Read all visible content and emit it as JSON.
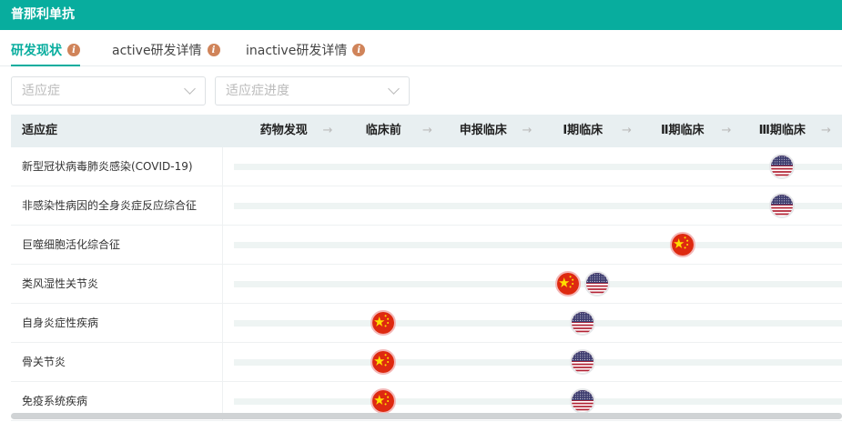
{
  "header": {
    "title": "普那利单抗"
  },
  "tabs": [
    {
      "label": "研发现状",
      "active": true
    },
    {
      "label": "active研发详情"
    },
    {
      "label": "inactive研发详情"
    }
  ],
  "info_icon_glyph": "i",
  "filters": [
    {
      "placeholder": "适应症"
    },
    {
      "placeholder": "适应症进度"
    }
  ],
  "table": {
    "label_header": "适应症",
    "stages": [
      "药物发现",
      "临床前",
      "申报临床",
      "Ⅰ期临床",
      "Ⅱ期临床",
      "Ⅲ期临床"
    ],
    "arrow_glyph": "→",
    "rows": [
      {
        "name": "新型冠状病毒肺炎感染(COVID-19)",
        "flags": [
          {
            "country": "US",
            "stage": 5
          }
        ]
      },
      {
        "name": "非感染性病因的全身炎症反应综合征",
        "flags": [
          {
            "country": "US",
            "stage": 5
          }
        ]
      },
      {
        "name": "巨噬细胞活化综合征",
        "flags": [
          {
            "country": "CN",
            "stage": 4
          }
        ]
      },
      {
        "name": "类风湿性关节炎",
        "flags": [
          {
            "country": "CN",
            "stage": 3,
            "pair": 0
          },
          {
            "country": "US",
            "stage": 3,
            "pair": 1
          }
        ]
      },
      {
        "name": "自身炎症性疾病",
        "flags": [
          {
            "country": "CN",
            "stage": 1
          },
          {
            "country": "US",
            "stage": 3
          }
        ]
      },
      {
        "name": "骨关节炎",
        "flags": [
          {
            "country": "CN",
            "stage": 1
          },
          {
            "country": "US",
            "stage": 3
          }
        ]
      },
      {
        "name": "免疫系统疾病",
        "flags": [
          {
            "country": "CN",
            "stage": 1
          },
          {
            "country": "US",
            "stage": 3
          }
        ]
      }
    ]
  },
  "colors": {
    "brand": "#08ad9e",
    "info": "#d0845a",
    "cn": "#de2910",
    "us_blue": "#3c3b6e",
    "us_red": "#b22234"
  }
}
